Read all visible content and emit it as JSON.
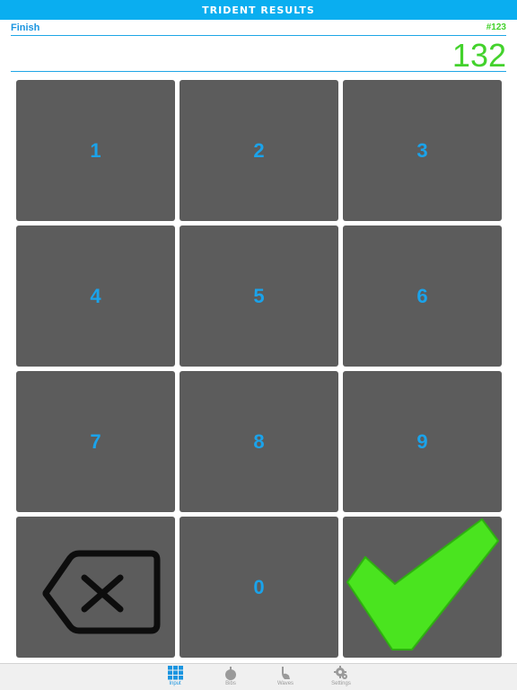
{
  "app": {
    "title": "TRIDENT RESULTS"
  },
  "header": {
    "event_label": "Finish",
    "race_number": "#123"
  },
  "display": {
    "value": "132"
  },
  "keypad": {
    "keys": [
      "1",
      "2",
      "3",
      "4",
      "5",
      "6",
      "7",
      "8",
      "9"
    ],
    "zero": "0",
    "backspace_icon": "backspace-icon",
    "confirm_icon": "checkmark-icon"
  },
  "tabs": [
    {
      "label": "Input",
      "icon": "grid-icon",
      "active": true
    },
    {
      "label": "Bibs",
      "icon": "bomb-icon",
      "active": false
    },
    {
      "label": "Waves",
      "icon": "wave-icon",
      "active": false
    },
    {
      "label": "Settings",
      "icon": "gear-icon",
      "active": false
    }
  ],
  "colors": {
    "accent_blue": "#0aaef0",
    "value_green": "#43d22c",
    "key_gray": "#5c5c5c",
    "digit_blue": "#1aa3eb"
  }
}
